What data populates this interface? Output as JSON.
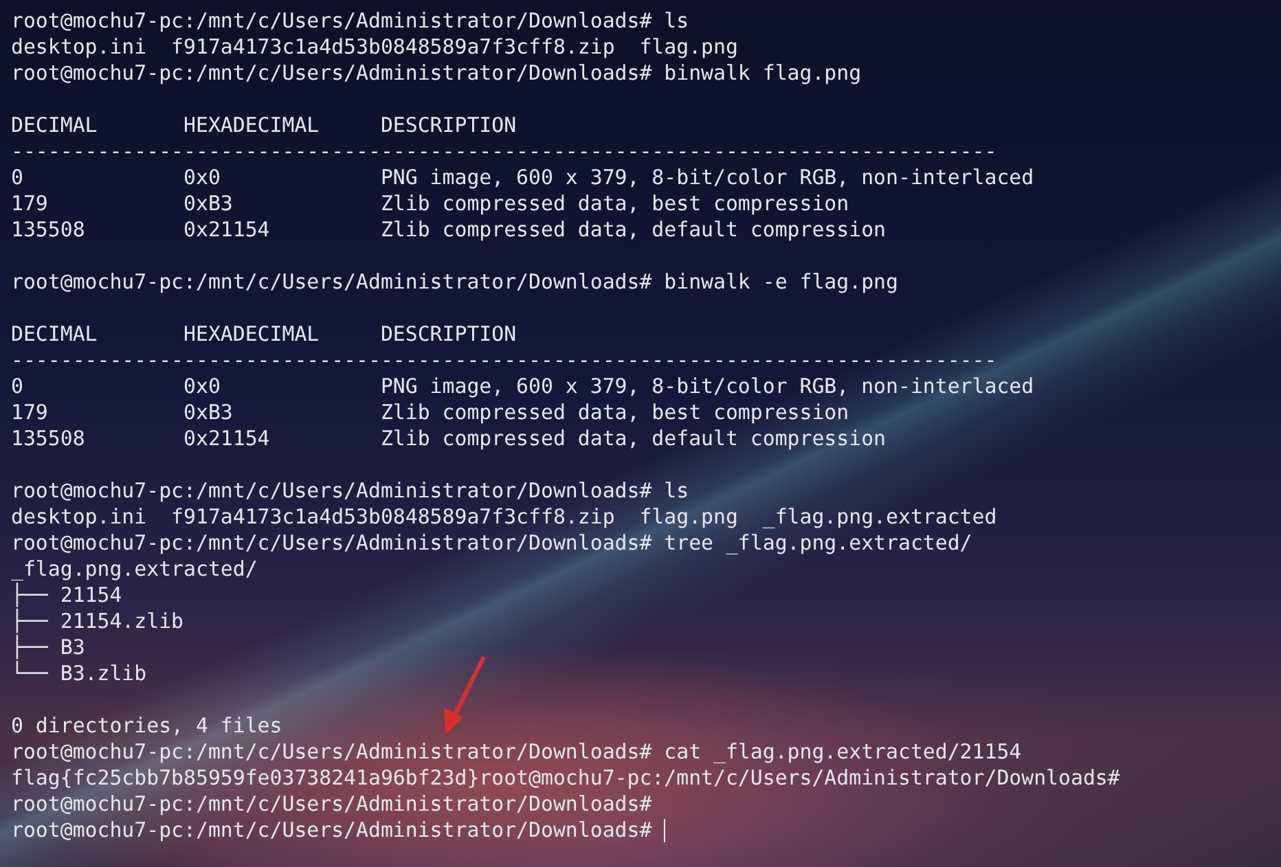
{
  "terminal": {
    "lines": [
      {
        "kind": "text",
        "text": "root@mochu7-pc:/mnt/c/Users/Administrator/Downloads# ls"
      },
      {
        "kind": "text",
        "text": "desktop.ini  f917a4173c1a4d53b0848589a7f3cff8.zip  flag.png"
      },
      {
        "kind": "text",
        "text": "root@mochu7-pc:/mnt/c/Users/Administrator/Downloads# binwalk flag.png"
      },
      {
        "kind": "blank"
      },
      {
        "kind": "text",
        "text": "DECIMAL       HEXADECIMAL     DESCRIPTION"
      },
      {
        "kind": "text",
        "text": "--------------------------------------------------------------------------------"
      },
      {
        "kind": "text",
        "text": "0             0x0             PNG image, 600 x 379, 8-bit/color RGB, non-interlaced"
      },
      {
        "kind": "text",
        "text": "179           0xB3            Zlib compressed data, best compression"
      },
      {
        "kind": "text",
        "text": "135508        0x21154         Zlib compressed data, default compression"
      },
      {
        "kind": "blank"
      },
      {
        "kind": "text",
        "text": "root@mochu7-pc:/mnt/c/Users/Administrator/Downloads# binwalk -e flag.png"
      },
      {
        "kind": "blank"
      },
      {
        "kind": "text",
        "text": "DECIMAL       HEXADECIMAL     DESCRIPTION"
      },
      {
        "kind": "text",
        "text": "--------------------------------------------------------------------------------"
      },
      {
        "kind": "text",
        "text": "0             0x0             PNG image, 600 x 379, 8-bit/color RGB, non-interlaced"
      },
      {
        "kind": "text",
        "text": "179           0xB3            Zlib compressed data, best compression"
      },
      {
        "kind": "text",
        "text": "135508        0x21154         Zlib compressed data, default compression"
      },
      {
        "kind": "blank"
      },
      {
        "kind": "text",
        "text": "root@mochu7-pc:/mnt/c/Users/Administrator/Downloads# ls"
      },
      {
        "kind": "text",
        "text": "desktop.ini  f917a4173c1a4d53b0848589a7f3cff8.zip  flag.png  _flag.png.extracted"
      },
      {
        "kind": "text",
        "text": "root@mochu7-pc:/mnt/c/Users/Administrator/Downloads# tree _flag.png.extracted/"
      },
      {
        "kind": "text",
        "text": "_flag.png.extracted/"
      },
      {
        "kind": "text",
        "text": "├── 21154"
      },
      {
        "kind": "text",
        "text": "├── 21154.zlib"
      },
      {
        "kind": "text",
        "text": "├── B3"
      },
      {
        "kind": "text",
        "text": "└── B3.zlib"
      },
      {
        "kind": "blank"
      },
      {
        "kind": "text",
        "text": "0 directories, 4 files"
      },
      {
        "kind": "text",
        "text": "root@mochu7-pc:/mnt/c/Users/Administrator/Downloads# cat _flag.png.extracted/21154"
      },
      {
        "kind": "text",
        "text": "flag{fc25cbb7b85959fe03738241a96bf23d}root@mochu7-pc:/mnt/c/Users/Administrator/Downloads#"
      },
      {
        "kind": "text",
        "text": "root@mochu7-pc:/mnt/c/Users/Administrator/Downloads#"
      },
      {
        "kind": "prompt",
        "text": "root@mochu7-pc:/mnt/c/Users/Administrator/Downloads#",
        "cursor": true
      }
    ]
  }
}
